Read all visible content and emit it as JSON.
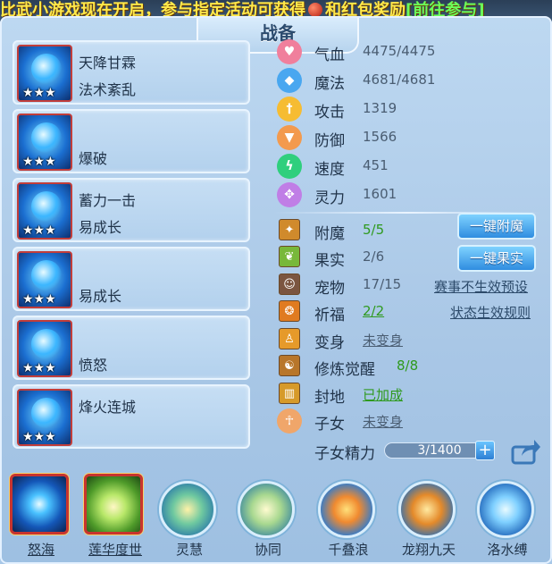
{
  "marquee": {
    "text_a": "比武小游戏现在开启，参与指定活动可获得",
    "text_b": "和红包奖励",
    "text_c": "[前往参与]"
  },
  "title": "战备",
  "skills": [
    {
      "name1": "天降甘霖",
      "name2": "法术紊乱",
      "stars": "★★★",
      "icon": "staff-skill-icon"
    },
    {
      "name1": "",
      "name2": "爆破",
      "stars": "★★★",
      "icon": "helmet-skill-icon"
    },
    {
      "name1": "蓄力一击",
      "name2": "易成长",
      "stars": "★★★",
      "icon": "crown-skill-icon"
    },
    {
      "name1": "",
      "name2": "易成长",
      "stars": "★★★",
      "icon": "swirl-skill-icon"
    },
    {
      "name1": "",
      "name2": "愤怒",
      "stars": "★★★",
      "icon": "ring-skill-icon"
    },
    {
      "name1": "烽火连城",
      "name2": "",
      "stars": "★★★",
      "icon": "fire-skill-icon"
    }
  ],
  "stats": [
    {
      "label": "气血",
      "value": "4475/4475",
      "icon": "heart-icon",
      "color": "#f07f9c"
    },
    {
      "label": "魔法",
      "value": "4681/4681",
      "icon": "mana-icon",
      "color": "#49a7f0"
    },
    {
      "label": "攻击",
      "value": "1319",
      "icon": "sword-icon",
      "color": "#f6bc32"
    },
    {
      "label": "防御",
      "value": "1566",
      "icon": "shield-icon",
      "color": "#f39a4e"
    },
    {
      "label": "速度",
      "value": "451",
      "icon": "speed-icon",
      "color": "#2fcf7d"
    },
    {
      "label": "灵力",
      "value": "1601",
      "icon": "spirit-icon",
      "color": "#c07ee6"
    }
  ],
  "extras": [
    {
      "label": "附魔",
      "value": "5/5",
      "icon": "enchant-icon",
      "green": true,
      "underline": false
    },
    {
      "label": "果实",
      "value": "2/6",
      "icon": "fruit-icon",
      "green": false,
      "underline": false
    },
    {
      "label": "宠物",
      "value": "17/15",
      "icon": "pet-icon",
      "green": false,
      "underline": false
    },
    {
      "label": "祈福",
      "value": "2/2",
      "icon": "blessing-icon",
      "green": true,
      "underline": true
    },
    {
      "label": "变身",
      "value": "未变身",
      "icon": "transform-icon",
      "green": false,
      "underline": true
    },
    {
      "label": "修炼觉醒",
      "value": "8/8",
      "icon": "awaken-icon",
      "green": true,
      "underline": false
    },
    {
      "label": "封地",
      "value": "已加成",
      "icon": "fief-icon",
      "green": true,
      "underline": true
    },
    {
      "label": "子女",
      "value": "未变身",
      "icon": "child-icon",
      "green": false,
      "underline": true
    }
  ],
  "buttons": {
    "enchant": "一键附魔",
    "fruit": "一键果实"
  },
  "links": {
    "preset": "赛事不生效预设",
    "rules": "状态生效规则"
  },
  "child_energy": {
    "label": "子女精力",
    "value": "3/1400",
    "fraction": 0.002
  },
  "bottom_skills": [
    {
      "label": "怒海",
      "style": "square",
      "underline": true,
      "icon": "blue-orb-icon"
    },
    {
      "label": "莲华度世",
      "style": "square",
      "underline": true,
      "icon": "lotus-hand-icon"
    },
    {
      "label": "灵慧",
      "style": "round",
      "underline": false,
      "icon": "wisdom-icon"
    },
    {
      "label": "协同",
      "style": "round",
      "underline": false,
      "icon": "cooperate-icon"
    },
    {
      "label": "千叠浪",
      "style": "round",
      "underline": false,
      "icon": "wave-icon"
    },
    {
      "label": "龙翔九天",
      "style": "round",
      "underline": false,
      "icon": "dragon-icon"
    },
    {
      "label": "洛水缚",
      "style": "round",
      "underline": false,
      "icon": "water-bind-icon"
    }
  ]
}
